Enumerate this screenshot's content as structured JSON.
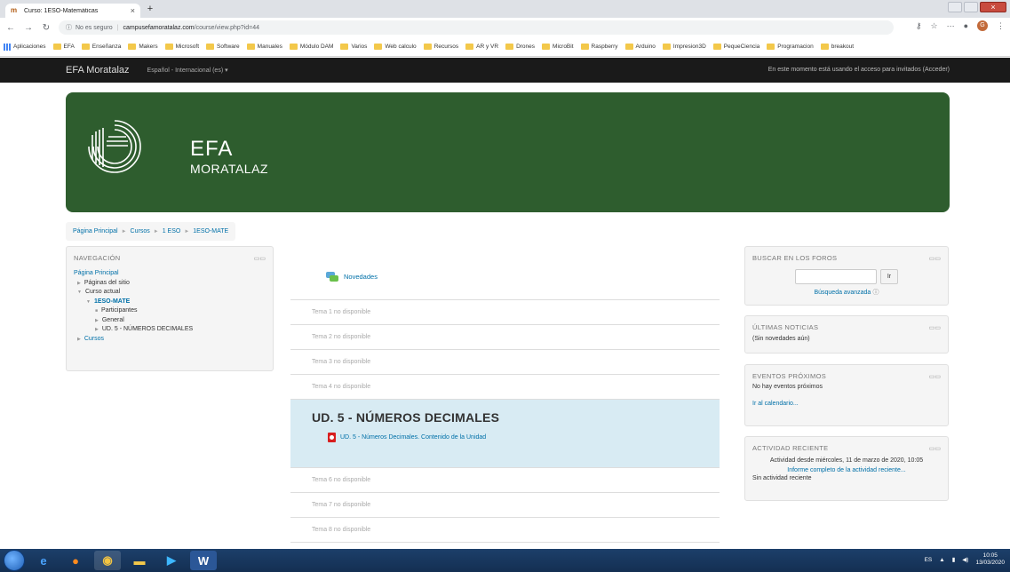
{
  "browser": {
    "tab_title": "Curso: 1ESO-Matemáticas",
    "tab_close": "×",
    "new_tab": "+",
    "url_security": "No es seguro",
    "url_host": "campusefamoratalaz.com",
    "url_path": "/course/view.php?id=44"
  },
  "bookmarks": [
    "Aplicaciones",
    "EFA",
    "Enseñanza",
    "Makers",
    "Microsoft",
    "Software",
    "Manuales",
    "Módulo DAM",
    "Varios",
    "Web calculo",
    "Recursos",
    "AR y VR",
    "Drones",
    "MicroBit",
    "Raspberry",
    "Arduino",
    "Impresion3D",
    "PequeCiencia",
    "Programacion",
    "breakout"
  ],
  "navbar": {
    "brand": "EFA Moratalaz",
    "language": "Español - Internacional (es) ▾",
    "guest_notice": "En este momento está usando el acceso para invitados (Acceder)"
  },
  "banner": {
    "line1": "EFA",
    "line2": "MORATALAZ"
  },
  "breadcrumb": [
    "Página Principal",
    "Cursos",
    "1 ESO",
    "1ESO-MATE"
  ],
  "navigation": {
    "title": "NAVEGACIÓN",
    "home": "Página Principal",
    "site_pages": "Páginas del sitio",
    "current_course": "Curso actual",
    "course": "1ESO-MATE",
    "participants": "Participantes",
    "general": "General",
    "unit": "UD. 5 - NÚMEROS DECIMALES",
    "courses": "Cursos"
  },
  "center": {
    "news": "Novedades",
    "topics_before": [
      "Tema 1 no disponible",
      "Tema 2 no disponible",
      "Tema 3 no disponible",
      "Tema 4 no disponible"
    ],
    "section_title": "UD. 5 - NÚMEROS DECIMALES",
    "resource": "UD. 5 - Números Decimales. Contenido de la Unidad",
    "topics_after": [
      "Tema 6 no disponible",
      "Tema 7 no disponible",
      "Tema 8 no disponible"
    ]
  },
  "search_forums": {
    "title": "BUSCAR EN LOS FOROS",
    "button": "Ir",
    "advanced": "Búsqueda avanzada"
  },
  "news_block": {
    "title": "ÚLTIMAS NOTICIAS",
    "text": "(Sin novedades aún)"
  },
  "events": {
    "title": "EVENTOS PRÓXIMOS",
    "text": "No hay eventos próximos",
    "link": "Ir al calendario..."
  },
  "activity": {
    "title": "ACTIVIDAD RECIENTE",
    "since": "Actividad desde miércoles, 11 de marzo de 2020, 10:05",
    "report": "Informe completo de la actividad reciente...",
    "none": "Sin actividad reciente"
  },
  "taskbar": {
    "lang": "ES",
    "time": "10:05",
    "date": "13/03/2020"
  },
  "colors": {
    "banner": "#2e5d2e",
    "link": "#0070a8",
    "current_section": "#d8ebf3",
    "navbar": "#1a1a1a"
  }
}
